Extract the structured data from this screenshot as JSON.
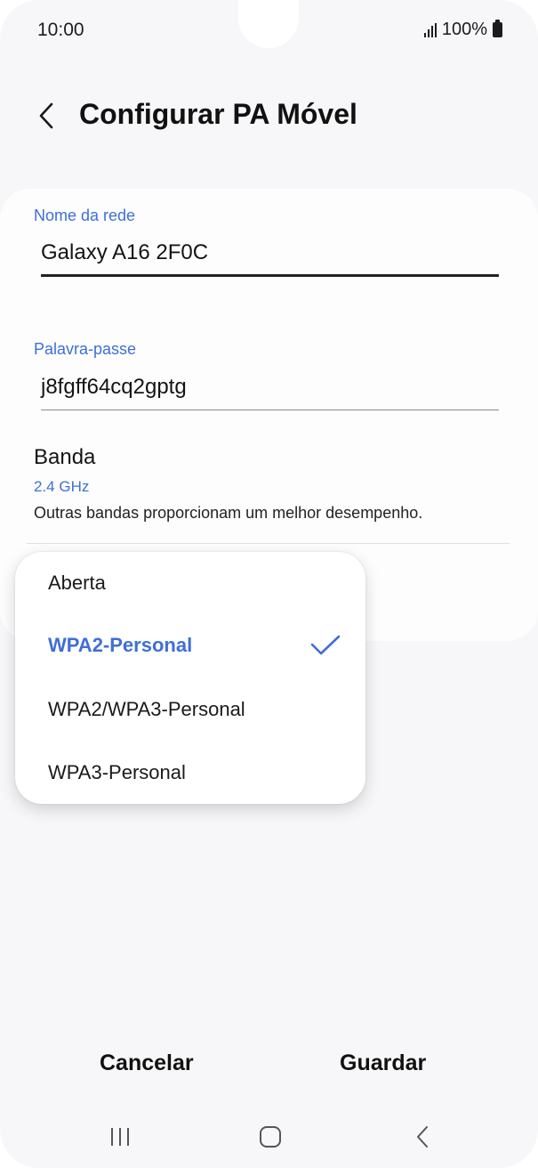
{
  "status_bar": {
    "time": "10:00",
    "battery": "100%",
    "icons": [
      "signal-icon",
      "battery-icon"
    ]
  },
  "header": {
    "title": "Configurar PA Móvel",
    "back_icon": "chevron-left-icon"
  },
  "form": {
    "network_name": {
      "label": "Nome da rede",
      "value": "Galaxy A16 2F0C"
    },
    "password": {
      "label": "Palavra-passe",
      "value": "j8fgff64cq2gptg"
    },
    "band": {
      "title": "Banda",
      "value": "2.4 GHz",
      "description": "Outras bandas proporcionam um melhor desempenho."
    }
  },
  "security_menu": {
    "options": [
      {
        "label": "Aberta",
        "selected": false
      },
      {
        "label": "WPA2-Personal",
        "selected": true
      },
      {
        "label": "WPA2/WPA3-Personal",
        "selected": false
      },
      {
        "label": "WPA3-Personal",
        "selected": false
      }
    ]
  },
  "actions": {
    "cancel_label": "Cancelar",
    "save_label": "Guardar"
  },
  "nav_bar": {
    "icons": [
      "recent-apps-icon",
      "home-icon",
      "back-icon"
    ]
  },
  "colors": {
    "accent": "#3f6fd6",
    "background": "#f7f7f9",
    "card": "#fdfdfe"
  }
}
